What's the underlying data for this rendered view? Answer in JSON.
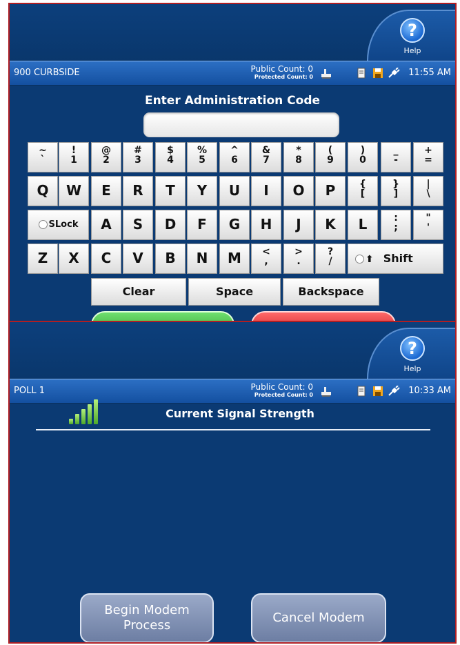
{
  "screen_top": {
    "help_label": "Help",
    "help_glyph": "?",
    "location": "900 CURBSIDE",
    "public_count": "Public Count: 0",
    "protected_count": "Protected Count: 0",
    "time": "11:55 AM",
    "prompt": "Enter Administration Code",
    "code_value": "",
    "keyboard": {
      "row1": [
        {
          "top": "~",
          "bottom": "`"
        },
        {
          "top": "!",
          "bottom": "1"
        },
        {
          "top": "@",
          "bottom": "2"
        },
        {
          "top": "#",
          "bottom": "3"
        },
        {
          "top": "$",
          "bottom": "4"
        },
        {
          "top": "%",
          "bottom": "5"
        },
        {
          "top": "^",
          "bottom": "6"
        },
        {
          "top": "&",
          "bottom": "7"
        },
        {
          "top": "*",
          "bottom": "8"
        },
        {
          "top": "(",
          "bottom": "9"
        },
        {
          "top": ")",
          "bottom": "0"
        },
        {
          "top": "_",
          "bottom": "-"
        },
        {
          "top": "+",
          "bottom": "="
        }
      ],
      "row2": [
        "Q",
        "W",
        "E",
        "R",
        "T",
        "Y",
        "U",
        "I",
        "O",
        "P",
        "{ [",
        "} ]",
        "| \\"
      ],
      "row2_top": {
        "p10": "{",
        "p11": "}",
        "p12": "|"
      },
      "row2_bottom": {
        "p10": "[",
        "p11": "]",
        "p12": "\\"
      },
      "row3_slock": "SLock",
      "row3": [
        "A",
        "S",
        "D",
        "F",
        "G",
        "H",
        "J",
        "K",
        "L"
      ],
      "row3_punct": [
        {
          "top": ":",
          "bottom": ";"
        },
        {
          "top": "\"",
          "bottom": "'"
        }
      ],
      "row4": [
        "Z",
        "X",
        "C",
        "V",
        "B",
        "N",
        "M"
      ],
      "row4_punct": [
        {
          "top": "<",
          "bottom": ","
        },
        {
          "top": ">",
          "bottom": "."
        },
        {
          "top": "?",
          "bottom": "/"
        }
      ],
      "shift": "Shift",
      "shift_arrow": "⬆",
      "clear": "Clear",
      "space": "Space",
      "backspace": "Backspace"
    }
  },
  "screen_bottom": {
    "help_label": "Help",
    "help_glyph": "?",
    "location": "POLL 1",
    "public_count": "Public Count: 0",
    "protected_count": "Protected Count: 0",
    "time": "10:33 AM",
    "signal_title": "Current Signal Strength",
    "signal_bars": 5,
    "begin_button": "Begin Modem Process",
    "cancel_button": "Cancel Modem"
  },
  "colors": {
    "background": "#0b3a73",
    "status_bar": "#1a5ab0",
    "frame": "#b01e23",
    "confirm_green": "#3aa83a",
    "cancel_red": "#d8232a"
  },
  "icons": [
    "help-icon",
    "printer-icon",
    "document-icon",
    "save-icon",
    "power-plug-icon",
    "signal-bars-icon",
    "shift-arrow-icon"
  ]
}
